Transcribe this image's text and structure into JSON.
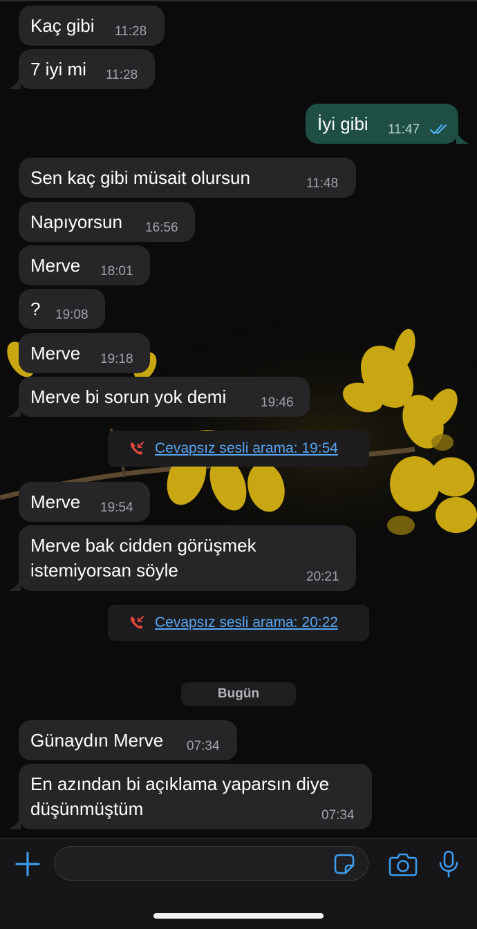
{
  "messages": [
    {
      "text": "Kaç gibi",
      "time": "11:28"
    },
    {
      "text": "7 iyi mi",
      "time": "11:28"
    },
    {
      "text": "İyi gibi",
      "time": "11:47",
      "status": "read"
    },
    {
      "text": "Sen kaç gibi müsait olursun",
      "time": "11:48"
    },
    {
      "text": "Napıyorsun",
      "time": "16:56"
    },
    {
      "text": "Merve",
      "time": "18:01"
    },
    {
      "text": "?",
      "time": "19:08"
    },
    {
      "text": "Merve",
      "time": "19:18"
    },
    {
      "text": "Merve bi sorun yok demi",
      "time": "19:46"
    },
    {
      "text": "Merve",
      "time": "19:54"
    },
    {
      "text_line1": "Merve bak cidden görüşmek",
      "text_line2": "istemiyorsan söyle",
      "time": "20:21"
    },
    {
      "text": "Günaydın Merve",
      "time": "07:34"
    },
    {
      "text_line1": "En azından bi açıklama yaparsın diye",
      "text_line2": "düşünmüştüm",
      "time": "07:34"
    }
  ],
  "missed_calls": [
    {
      "label": "Cevapsız sesli arama: 19:54"
    },
    {
      "label": "Cevapsız sesli arama: 20:22"
    }
  ],
  "date_separator": "Bugün",
  "composer": {
    "value": ""
  },
  "colors": {
    "incoming_bubble": "#262628",
    "outgoing_bubble": "#1f4e44",
    "link": "#58a6f5",
    "missed_call_icon": "#e5463c",
    "read_ticks": "#4fb3f5"
  },
  "icons": {
    "attach": "plus-icon",
    "sticker": "sticker-icon",
    "camera": "camera-icon",
    "voice": "mic-icon",
    "call": "missed-call-icon"
  }
}
